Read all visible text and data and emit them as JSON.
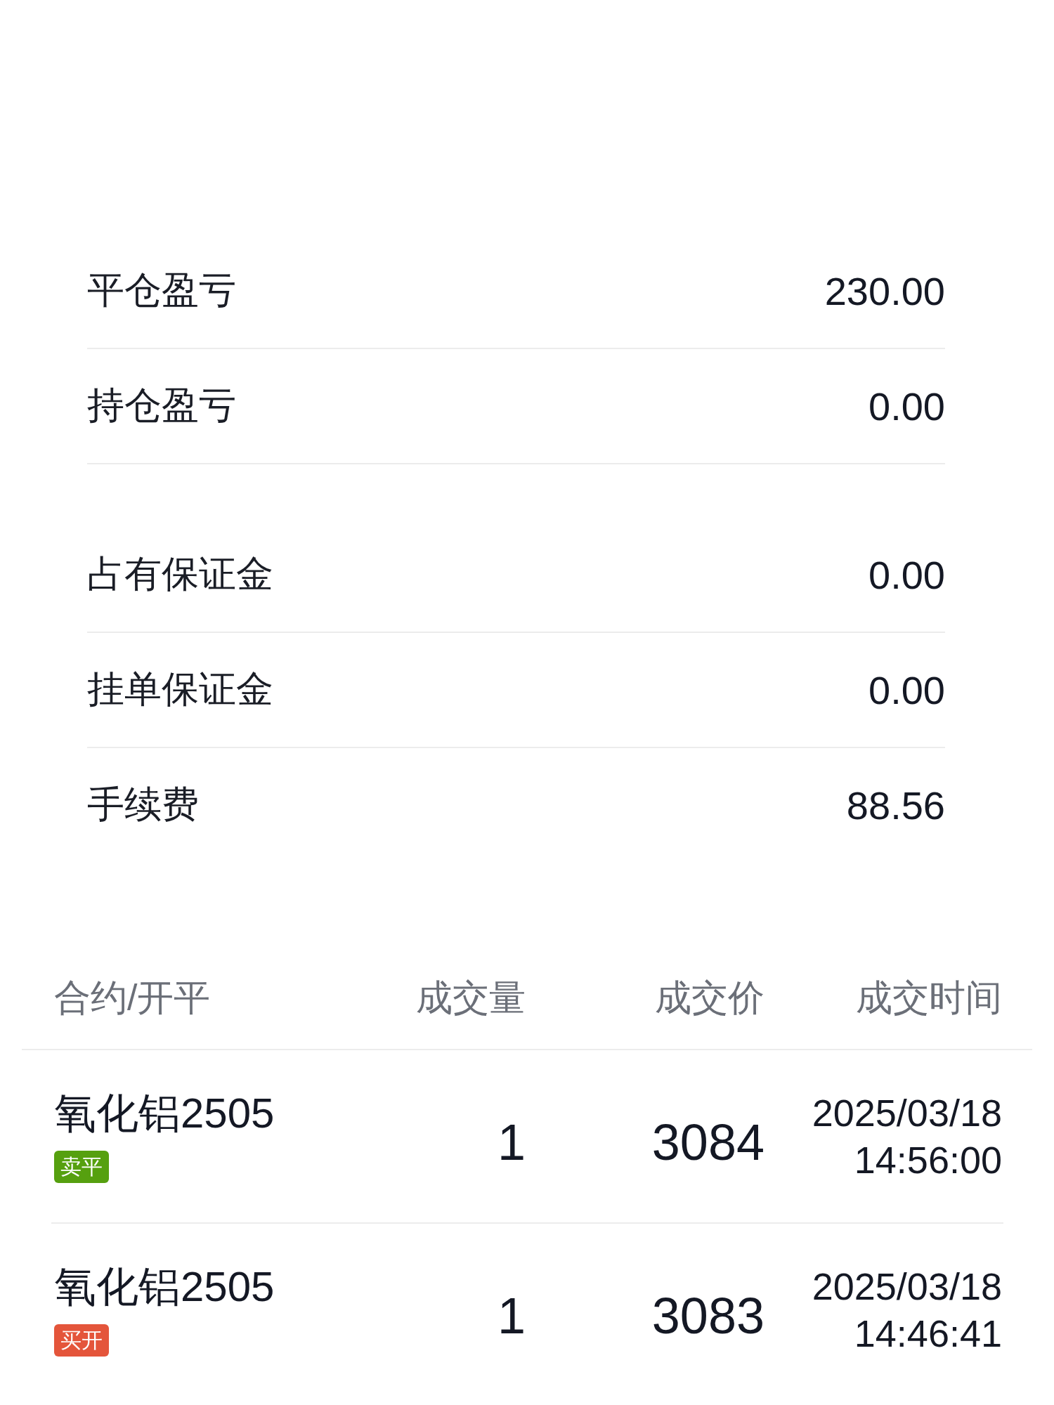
{
  "summary_groups": [
    {
      "rows": [
        {
          "label": "平仓盈亏",
          "value": "230.00"
        },
        {
          "label": "持仓盈亏",
          "value": "0.00"
        }
      ]
    },
    {
      "rows": [
        {
          "label": "占有保证金",
          "value": "0.00"
        },
        {
          "label": "挂单保证金",
          "value": "0.00"
        },
        {
          "label": "手续费",
          "value": "88.56"
        }
      ]
    }
  ],
  "trades": {
    "columns": [
      "合约/开平",
      "成交量",
      "成交价",
      "成交时间"
    ],
    "rows": [
      {
        "contract": "氧化铝2505",
        "tag": {
          "label": "卖平",
          "color": "#56a00f"
        },
        "volume": "1",
        "price": "3084",
        "date": "2025/03/18",
        "time": "14:56:00"
      },
      {
        "contract": "氧化铝2505",
        "tag": {
          "label": "买开",
          "color": "#e4553b"
        },
        "volume": "1",
        "price": "3083",
        "date": "2025/03/18",
        "time": "14:46:41"
      }
    ]
  }
}
